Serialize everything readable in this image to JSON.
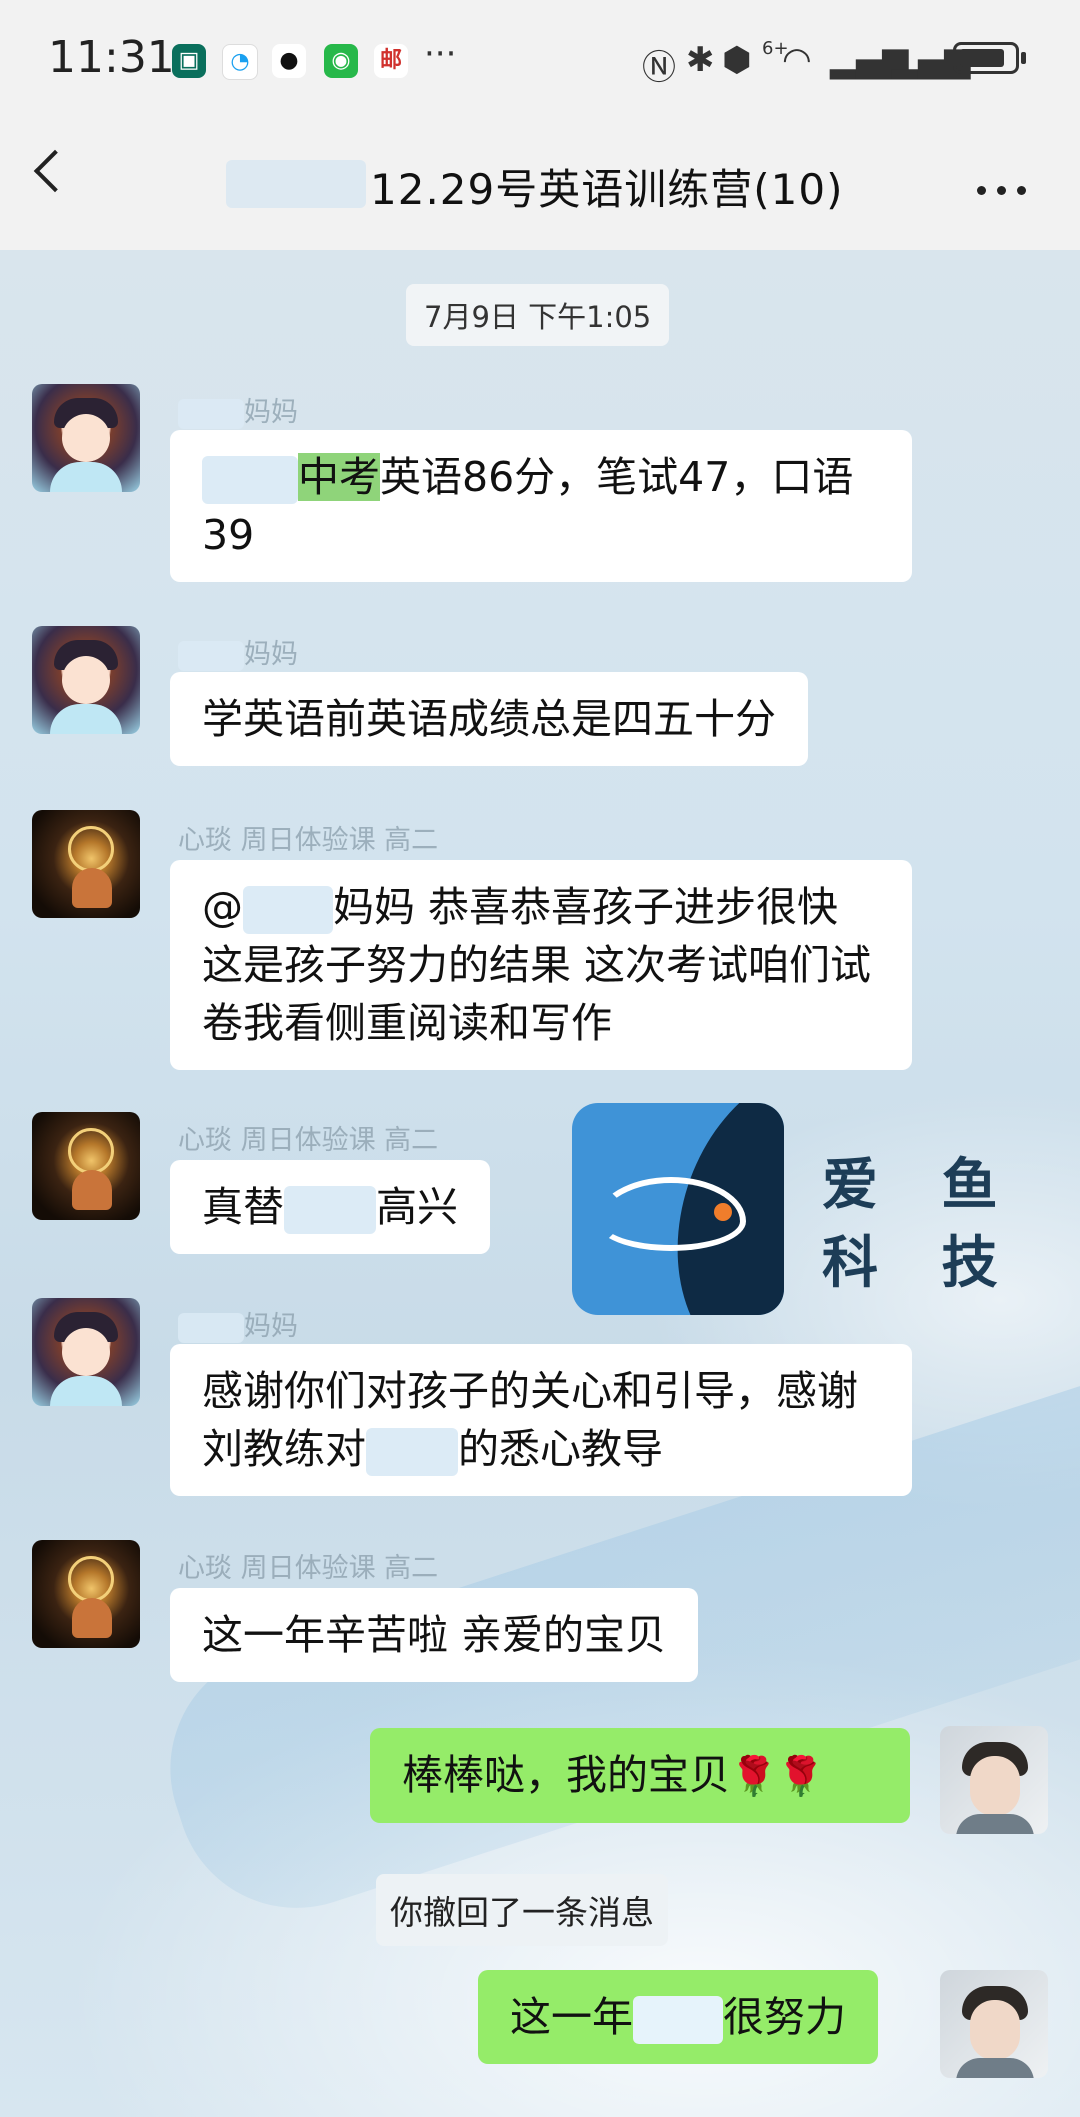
{
  "status_bar": {
    "time": "11:31",
    "notif_mail": "邮",
    "more": "···",
    "network": "6+"
  },
  "header": {
    "title": "12.29号英语训练营(10)"
  },
  "chat": {
    "timestamp": "7月9日 下午1:05",
    "messages": [
      {
        "sender": "妈妈",
        "pre": "",
        "highlight": "中考",
        "text": "英语86分，笔试47，口语39"
      },
      {
        "sender": "妈妈",
        "text": "学英语前英语成绩总是四五十分"
      },
      {
        "sender": "心琰 周日体验课 高二",
        "text_a": "@",
        "text_b": "妈妈   恭喜恭喜孩子进步很快   这是孩子努力的结果   这次考试咱们试卷我看侧重阅读和写作"
      },
      {
        "sender": "心琰 周日体验课 高二",
        "text_a": "真替",
        "text_b": "高兴"
      },
      {
        "sender": "妈妈",
        "text_a": "感谢你们对孩子的关心和引导，感谢刘教练对",
        "text_b": "的悉心教导"
      },
      {
        "sender": "心琰 周日体验课 高二",
        "text": "这一年辛苦啦   亲爱的宝贝"
      },
      {
        "sender": "me",
        "text": "棒棒哒，我的宝贝",
        "emoji": "🌹🌹"
      },
      {
        "sender": "me",
        "text_a": "这一年",
        "text_b": "很努力"
      }
    ],
    "recall_notice": "你撤回了一条消息"
  },
  "watermark": {
    "line1": "爱 鱼",
    "line2": "科 技"
  },
  "colors": {
    "bubble_self": "#95ec69",
    "bubble_other": "#ffffff",
    "header_bg": "#f2f2f2"
  }
}
